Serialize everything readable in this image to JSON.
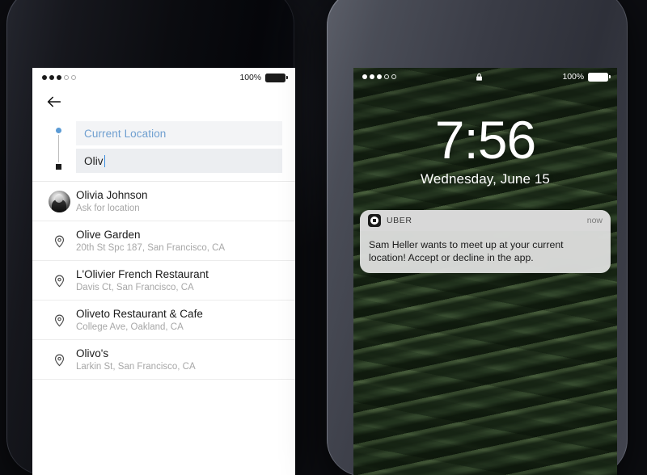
{
  "left_phone": {
    "status_bar": {
      "signal_dots_filled": 3,
      "signal_dots_total": 5,
      "battery_percent": "100%"
    },
    "back_button_label": "back-arrow",
    "route": {
      "origin_value": "Current Location",
      "destination_value": "Oliv"
    },
    "results": [
      {
        "icon": "avatar",
        "title": "Olivia Johnson",
        "subtitle": "Ask for location"
      },
      {
        "icon": "map-pin",
        "title": "Olive Garden",
        "subtitle": "20th St Spc 187, San Francisco, CA"
      },
      {
        "icon": "map-pin",
        "title": "L'Olivier French Restaurant",
        "subtitle": "Davis Ct, San Francisco, CA"
      },
      {
        "icon": "map-pin",
        "title": "Oliveto Restaurant & Cafe",
        "subtitle": "College Ave, Oakland, CA"
      },
      {
        "icon": "map-pin",
        "title": "Olivo's",
        "subtitle": "Larkin St, San Francisco, CA"
      }
    ]
  },
  "right_phone": {
    "status_bar": {
      "signal_dots_filled": 3,
      "signal_dots_total": 5,
      "battery_percent": "100%",
      "lock_icon": "lock-icon"
    },
    "lock_screen": {
      "time": "7:56",
      "date": "Wednesday, June 15"
    },
    "notification": {
      "app_name": "UBER",
      "timestamp": "now",
      "message": "Sam Heller wants to meet up at your current location! Accept or decline in the app."
    }
  },
  "colors": {
    "accent_blue": "#5b9bd5",
    "caret_blue": "#3b8ee0",
    "text_primary": "#1b1b1b",
    "text_secondary": "#a7a7a7",
    "field_bg": "#eceef1"
  }
}
